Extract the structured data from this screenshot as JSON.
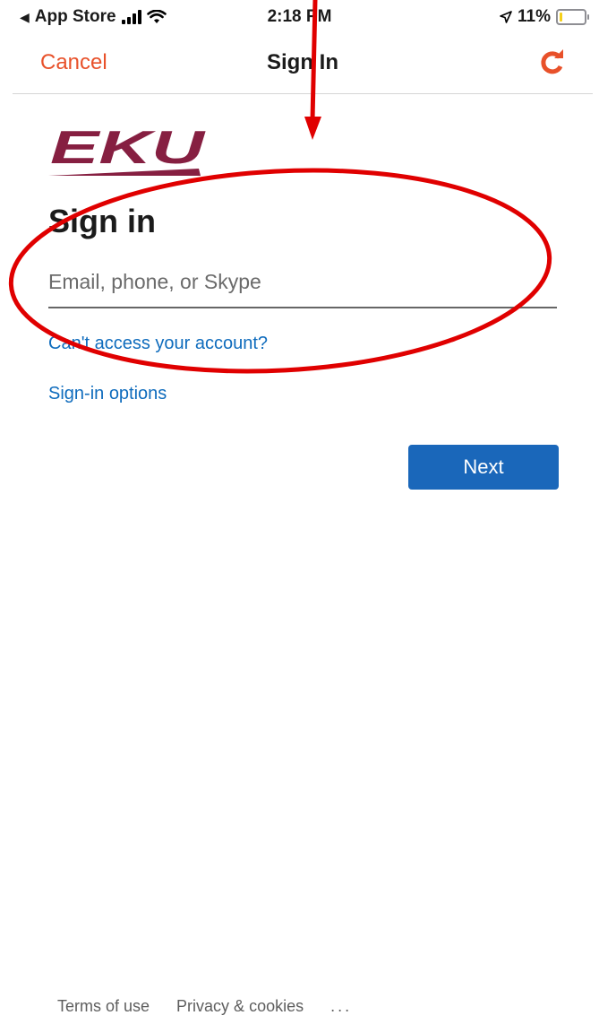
{
  "status_bar": {
    "back_app": "App Store",
    "time": "2:18 PM",
    "battery": "11%",
    "battery_level": 0.11
  },
  "nav": {
    "cancel_label": "Cancel",
    "title": "Sign In"
  },
  "logo": {
    "text": "EKU"
  },
  "form": {
    "heading": "Sign in",
    "email_placeholder": "Email, phone, or Skype",
    "email_value": "",
    "cant_access_link": "Can't access your account?",
    "signin_options_link": "Sign-in options",
    "next_label": "Next"
  },
  "footer": {
    "terms": "Terms of use",
    "privacy": "Privacy & cookies",
    "more": "..."
  },
  "colors": {
    "accent_orange": "#e8512a",
    "link_blue": "#0f6cbd",
    "button_blue": "#1a67ba",
    "logo_maroon": "#861f41",
    "annotation_red": "#e00000"
  },
  "icons": {
    "back_arrow": "back-triangle-icon",
    "signal": "cellular-signal-icon",
    "wifi": "wifi-icon",
    "location": "location-arrow-icon",
    "battery": "battery-icon",
    "refresh": "refresh-icon"
  }
}
